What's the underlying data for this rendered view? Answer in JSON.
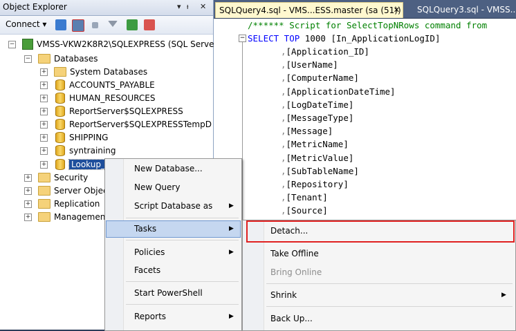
{
  "object_explorer": {
    "title": "Object Explorer",
    "title_controls": [
      "▾",
      "📌",
      "✕"
    ],
    "toolbar": {
      "connect_label": "Connect ▾"
    },
    "tree": {
      "server": "VMSS-VKW2K8R2\\SQLEXPRESS (SQL Serve",
      "databases_label": "Databases",
      "databases": [
        "System Databases",
        "ACCOUNTS_PAYABLE",
        "HUMAN_RESOURCES",
        "ReportServer$SQLEXPRESS",
        "ReportServer$SQLEXPRESSTempDB",
        "SHIPPING",
        "syntraining",
        "Lookup_T"
      ],
      "top_nodes": [
        "Security",
        "Server Objec",
        "Replication",
        "Management"
      ]
    }
  },
  "query_tabs": [
    {
      "label": "SQLQuery4.sql - VMS...ESS.master (sa (51))",
      "close": "✕"
    },
    {
      "label": "SQLQuery3.sql - VMSS..."
    }
  ],
  "editor": {
    "comment": "/****** Script for SelectTopNRows command from",
    "select_keyword": "SELECT TOP",
    "top_n": "1000",
    "first_col": "[In_ApplicationLogID]",
    "columns": [
      "[Application_ID]",
      "[UserName]",
      "[ComputerName]",
      "[ApplicationDateTime]",
      "[LogDateTime]",
      "[MessageType]",
      "[Message]",
      "[MetricName]",
      "[MetricValue]",
      "[SubTableName]",
      "[Repository]",
      "[Tenant]",
      "[Source]"
    ],
    "comma": ","
  },
  "context_menu": {
    "items": [
      {
        "label": "New Database..."
      },
      {
        "label": "New Query"
      },
      {
        "label": "Script Database as",
        "submenu": true
      },
      {
        "label": "Tasks",
        "submenu": true,
        "highlighted": true
      },
      {
        "label": "Policies",
        "submenu": true
      },
      {
        "label": "Facets"
      },
      {
        "label": "Start PowerShell"
      },
      {
        "label": "Reports",
        "submenu": true
      }
    ]
  },
  "tasks_submenu": {
    "items": [
      {
        "label": "Detach..."
      },
      {
        "label": "Take Offline"
      },
      {
        "label": "Bring Online",
        "disabled": true
      },
      {
        "label": "Shrink",
        "submenu": true
      },
      {
        "label": "Back Up..."
      }
    ]
  },
  "colors": {
    "highlight": "#e02020",
    "menu_selected": "#c5d7f0",
    "keyword": "#0000ff",
    "comment": "#008000"
  }
}
